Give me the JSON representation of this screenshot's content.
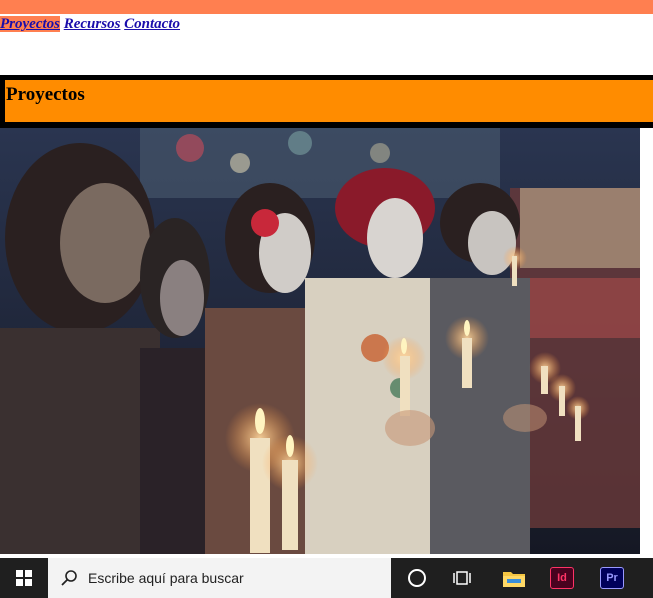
{
  "nav": {
    "items": [
      {
        "label": "Proyectos",
        "active": true
      },
      {
        "label": "Recursos",
        "active": false
      },
      {
        "label": "Contacto",
        "active": false
      }
    ]
  },
  "header": {
    "title": "Proyectos"
  },
  "photo": {
    "subject": "day-of-the-dead-candle-procession"
  },
  "taskbar": {
    "search_placeholder": "Escribe aquí para buscar",
    "apps": [
      {
        "icon": "file-explorer-icon"
      },
      {
        "icon": "indesign-icon",
        "label": "Id"
      },
      {
        "icon": "premiere-icon",
        "label": "Pr"
      }
    ]
  },
  "colors": {
    "topbar": "#ff7f50",
    "header_bg": "#ff8c00",
    "link": "#1a0dab",
    "taskbar": "#1f1f1f"
  }
}
